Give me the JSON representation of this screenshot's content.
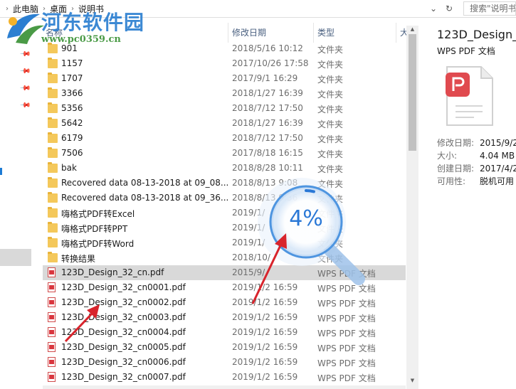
{
  "address_bar": {
    "crumbs": [
      "此电脑",
      "桌面",
      "说明书"
    ],
    "search_placeholder": "搜索\"说明书\""
  },
  "watermark": {
    "title": "河东软件园",
    "url": "www.pc0359.cn"
  },
  "columns": {
    "name": "名称",
    "date": "修改日期",
    "type": "类型",
    "size": "大"
  },
  "files": [
    {
      "name": "901",
      "date": "2018/5/16 10:12",
      "type": "文件夹",
      "kind": "folder"
    },
    {
      "name": "1157",
      "date": "2017/10/26 17:58",
      "type": "文件夹",
      "kind": "folder"
    },
    {
      "name": "1707",
      "date": "2017/9/1 16:29",
      "type": "文件夹",
      "kind": "folder"
    },
    {
      "name": "3366",
      "date": "2018/1/27 16:39",
      "type": "文件夹",
      "kind": "folder"
    },
    {
      "name": "5356",
      "date": "2018/7/12 17:50",
      "type": "文件夹",
      "kind": "folder"
    },
    {
      "name": "5642",
      "date": "2018/1/27 16:39",
      "type": "文件夹",
      "kind": "folder"
    },
    {
      "name": "6179",
      "date": "2018/7/12 17:50",
      "type": "文件夹",
      "kind": "folder"
    },
    {
      "name": "7506",
      "date": "2017/8/18 16:15",
      "type": "文件夹",
      "kind": "folder"
    },
    {
      "name": "bak",
      "date": "2018/8/28 10:11",
      "type": "文件夹",
      "kind": "folder"
    },
    {
      "name": "Recovered data 08-13-2018 at 09_08...",
      "date": "2018/8/13 9:08",
      "type": "文件夹",
      "kind": "folder"
    },
    {
      "name": "Recovered data 08-13-2018 at 09_36...",
      "date": "2018/8/13 9:36",
      "type": "文件夹",
      "kind": "folder"
    },
    {
      "name": "嗨格式PDF转Excel",
      "date": "2019/1/",
      "type": "文件夹",
      "kind": "folder"
    },
    {
      "name": "嗨格式PDF转PPT",
      "date": "2019/1/",
      "type": "文件夹",
      "kind": "folder"
    },
    {
      "name": "嗨格式PDF转Word",
      "date": "2019/1/",
      "type": "文件夹",
      "kind": "folder"
    },
    {
      "name": "转换结果",
      "date": "2018/10/",
      "type": "文件夹",
      "kind": "folder"
    },
    {
      "name": "123D_Design_32_cn.pdf",
      "date": "2015/9/",
      "type": "WPS PDF 文档",
      "kind": "pdf",
      "selected": true
    },
    {
      "name": "123D_Design_32_cn0001.pdf",
      "date": "2019/1/2 16:59",
      "type": "WPS PDF 文档",
      "kind": "pdf"
    },
    {
      "name": "123D_Design_32_cn0002.pdf",
      "date": "2019/1/2 16:59",
      "type": "WPS PDF 文档",
      "kind": "pdf"
    },
    {
      "name": "123D_Design_32_cn0003.pdf",
      "date": "2019/1/2 16:59",
      "type": "WPS PDF 文档",
      "kind": "pdf"
    },
    {
      "name": "123D_Design_32_cn0004.pdf",
      "date": "2019/1/2 16:59",
      "type": "WPS PDF 文档",
      "kind": "pdf"
    },
    {
      "name": "123D_Design_32_cn0005.pdf",
      "date": "2019/1/2 16:59",
      "type": "WPS PDF 文档",
      "kind": "pdf"
    },
    {
      "name": "123D_Design_32_cn0006.pdf",
      "date": "2019/1/2 16:59",
      "type": "WPS PDF 文档",
      "kind": "pdf"
    },
    {
      "name": "123D_Design_32_cn0007.pdf",
      "date": "2019/1/2 16:59",
      "type": "WPS PDF 文档",
      "kind": "pdf"
    }
  ],
  "progress": {
    "text": "4%",
    "value_percent": 4
  },
  "preview": {
    "title": "123D_Design_3",
    "subtitle": "WPS PDF 文档",
    "props": [
      {
        "key": "修改日期:",
        "value": "2015/9/2"
      },
      {
        "key": "大小:",
        "value": "4.04 MB"
      },
      {
        "key": "创建日期:",
        "value": "2017/4/2"
      },
      {
        "key": "可用性:",
        "value": "脱机可用"
      }
    ]
  },
  "colors": {
    "accent": "#2a78d6",
    "selection": "#d9d9d9",
    "folder": "#f4c85b",
    "pdf_red": "#e04a4f",
    "arrow": "#d8242c"
  }
}
